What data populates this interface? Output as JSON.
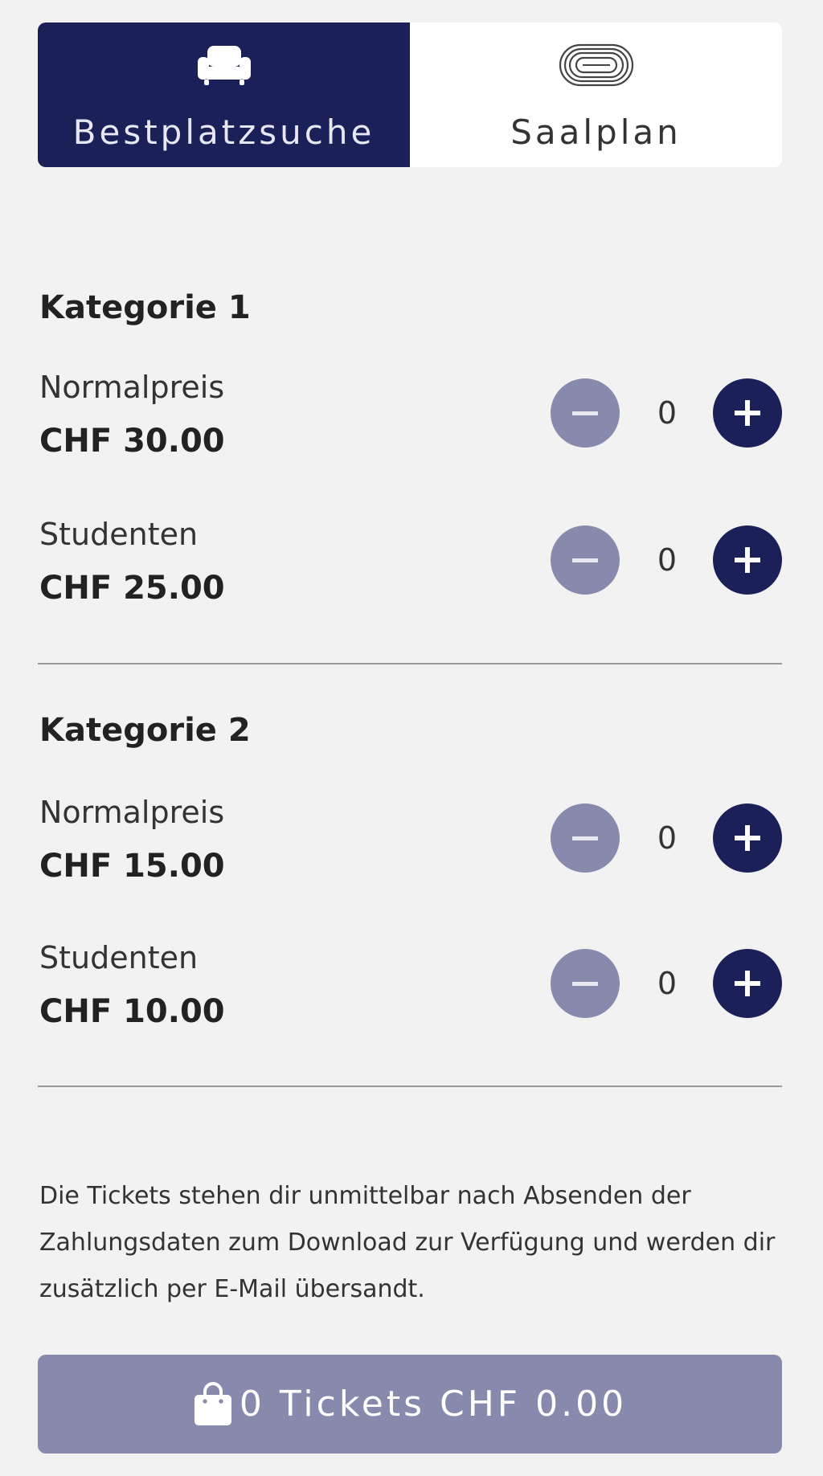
{
  "tabs": [
    {
      "label": "Bestplatzsuche",
      "icon": "armchair-icon",
      "active": true
    },
    {
      "label": "Saalplan",
      "icon": "stadium-icon",
      "active": false
    }
  ],
  "categories": [
    {
      "title": "Kategorie 1",
      "rows": [
        {
          "label": "Normalpreis",
          "price": "CHF 30.00",
          "quantity": "0"
        },
        {
          "label": "Studenten",
          "price": "CHF 25.00",
          "quantity": "0"
        }
      ]
    },
    {
      "title": "Kategorie 2",
      "rows": [
        {
          "label": "Normalpreis",
          "price": "CHF 15.00",
          "quantity": "0"
        },
        {
          "label": "Studenten",
          "price": "CHF 10.00",
          "quantity": "0"
        }
      ]
    }
  ],
  "info_text": "Die Tickets stehen dir unmittelbar nach Absenden der Zahlungsdaten zum Download zur Verfügung und werden dir zusätzlich per E-Mail übersandt.",
  "cart": {
    "label": "0 Tickets CHF 0.00",
    "icon": "shopping-bag-icon"
  },
  "colors": {
    "primary": "#1c2058",
    "disabled": "#8789ad",
    "background": "#f2f2f2"
  }
}
